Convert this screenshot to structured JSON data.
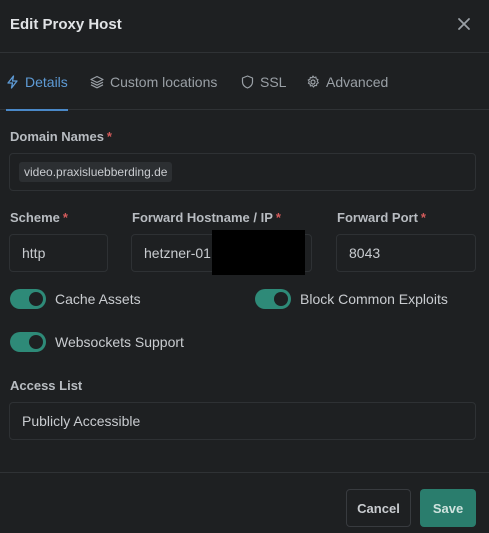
{
  "header": {
    "title": "Edit Proxy Host"
  },
  "tabs": [
    {
      "label": "Details",
      "icon": "bolt-icon",
      "active": true
    },
    {
      "label": "Custom locations",
      "icon": "layers-icon",
      "active": false
    },
    {
      "label": "SSL",
      "icon": "shield-icon",
      "active": false
    },
    {
      "label": "Advanced",
      "icon": "gear-icon",
      "active": false
    }
  ],
  "form": {
    "domain_names": {
      "label": "Domain Names",
      "required": "*",
      "values": [
        "video.praxisluebberding.de"
      ]
    },
    "scheme": {
      "label": "Scheme",
      "required": "*",
      "value": "http"
    },
    "forward_host": {
      "label": "Forward Hostname / IP",
      "required": "*",
      "value": "hetzner-01"
    },
    "forward_port": {
      "label": "Forward Port",
      "required": "*",
      "value": "8043"
    },
    "toggles": {
      "cache_assets": {
        "label": "Cache Assets",
        "enabled": true
      },
      "block_exploits": {
        "label": "Block Common Exploits",
        "enabled": true
      },
      "websockets": {
        "label": "Websockets Support",
        "enabled": true
      }
    },
    "access_list": {
      "label": "Access List",
      "value": "Publicly Accessible"
    }
  },
  "footer": {
    "cancel_label": "Cancel",
    "save_label": "Save"
  },
  "colors": {
    "background": "#1e2022",
    "accent_blue": "#5e9bd6",
    "toggle_on": "#2e8a78",
    "save_button": "#2a7d6d",
    "required": "#d45b5b"
  }
}
